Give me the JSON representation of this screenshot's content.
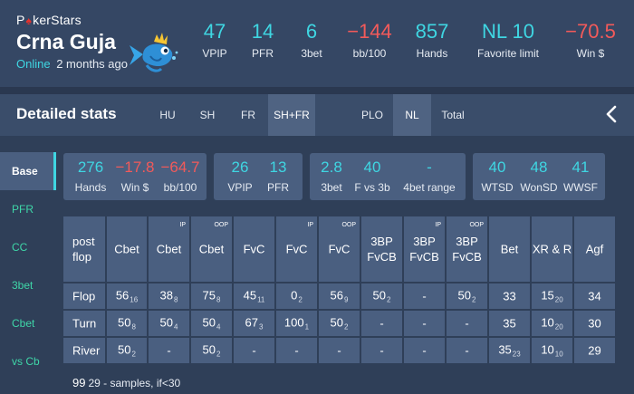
{
  "profile": {
    "brand": "PokerStars",
    "username": "Crna Guja",
    "online_label": "Online",
    "last_seen": "2 months ago"
  },
  "top_stats": [
    {
      "value": "47",
      "label": "VPIP",
      "tone": "cyan"
    },
    {
      "value": "14",
      "label": "PFR",
      "tone": "cyan"
    },
    {
      "value": "6",
      "label": "3bet",
      "tone": "cyan"
    },
    {
      "value": "−144",
      "label": "bb/100",
      "tone": "red"
    },
    {
      "value": "857",
      "label": "Hands",
      "tone": "cyan"
    },
    {
      "value": "NL 10",
      "label": "Favorite limit",
      "tone": "cyan"
    },
    {
      "value": "−70.5",
      "label": "Win $",
      "tone": "red"
    }
  ],
  "detailed": {
    "title": "Detailed stats",
    "format_tabs": [
      "HU",
      "SH",
      "FR",
      "SH+FR"
    ],
    "active_format": "SH+FR",
    "game_tabs": [
      "PLO",
      "NL",
      "Total"
    ],
    "active_game": "NL"
  },
  "sidenav": [
    "Base",
    "PFR",
    "CC",
    "3bet",
    "Cbet",
    "vs Cb"
  ],
  "cards": [
    [
      {
        "value": "276",
        "label": "Hands",
        "tone": "cyan"
      },
      {
        "value": "−17.8",
        "label": "Win $",
        "tone": "red"
      },
      {
        "value": "−64.7",
        "label": "bb/100",
        "tone": "red"
      }
    ],
    [
      {
        "value": "26",
        "label": "VPIP",
        "tone": "cyan"
      },
      {
        "value": "13",
        "label": "PFR",
        "tone": "cyan"
      }
    ],
    [
      {
        "value": "2.8",
        "label": "3bet",
        "tone": "cyan"
      },
      {
        "value": "40",
        "label": "F vs 3b",
        "tone": "cyan"
      },
      {
        "value": "-",
        "label": "4bet range",
        "tone": "cyan"
      }
    ],
    [
      {
        "value": "40",
        "label": "WTSD",
        "tone": "cyan"
      },
      {
        "value": "48",
        "label": "WonSD",
        "tone": "cyan"
      },
      {
        "value": "41",
        "label": "WWSF",
        "tone": "cyan"
      }
    ]
  ],
  "table": {
    "corner": [
      "post",
      "flop"
    ],
    "columns": [
      {
        "label": [
          "Cbet"
        ],
        "sup": ""
      },
      {
        "label": [
          "Cbet"
        ],
        "sup": "IP"
      },
      {
        "label": [
          "Cbet"
        ],
        "sup": "OOP"
      },
      {
        "label": [
          "FvC"
        ],
        "sup": ""
      },
      {
        "label": [
          "FvC"
        ],
        "sup": "IP"
      },
      {
        "label": [
          "FvC"
        ],
        "sup": "OOP"
      },
      {
        "label": [
          "3BP",
          "FvCB"
        ],
        "sup": ""
      },
      {
        "label": [
          "3BP",
          "FvCB"
        ],
        "sup": "IP"
      },
      {
        "label": [
          "3BP",
          "FvCB"
        ],
        "sup": "OOP"
      },
      {
        "label": [
          "Bet"
        ],
        "sup": ""
      },
      {
        "label": [
          "XR & R"
        ],
        "sup": ""
      },
      {
        "label": [
          "Agf"
        ],
        "sup": ""
      }
    ],
    "rows": [
      {
        "label": "Flop",
        "cells": [
          [
            "56",
            "16"
          ],
          [
            "38",
            "8"
          ],
          [
            "75",
            "8"
          ],
          [
            "45",
            "11"
          ],
          [
            "0",
            "2"
          ],
          [
            "56",
            "9"
          ],
          [
            "50",
            "2"
          ],
          [
            "-",
            ""
          ],
          [
            "50",
            "2"
          ],
          [
            "33",
            ""
          ],
          [
            "15",
            "20"
          ],
          [
            "34",
            ""
          ]
        ]
      },
      {
        "label": "Turn",
        "cells": [
          [
            "50",
            "8"
          ],
          [
            "50",
            "4"
          ],
          [
            "50",
            "4"
          ],
          [
            "67",
            "3"
          ],
          [
            "100",
            "1"
          ],
          [
            "50",
            "2"
          ],
          [
            "-",
            ""
          ],
          [
            "-",
            ""
          ],
          [
            "-",
            ""
          ],
          [
            "35",
            ""
          ],
          [
            "10",
            "20"
          ],
          [
            "30",
            ""
          ]
        ]
      },
      {
        "label": "River",
        "cells": [
          [
            "50",
            "2"
          ],
          [
            "-",
            ""
          ],
          [
            "50",
            "2"
          ],
          [
            "-",
            ""
          ],
          [
            "-",
            ""
          ],
          [
            "-",
            ""
          ],
          [
            "-",
            ""
          ],
          [
            "-",
            ""
          ],
          [
            "-",
            ""
          ],
          [
            "35",
            "23"
          ],
          [
            "10",
            "10"
          ],
          [
            "29",
            ""
          ]
        ]
      }
    ]
  },
  "footnote": {
    "count": "99",
    "text": "29 - samples, if<30"
  },
  "colors": {
    "accent": "#3fd6e2",
    "negative": "#f25a5a",
    "nav_green": "#3fd6a8"
  }
}
